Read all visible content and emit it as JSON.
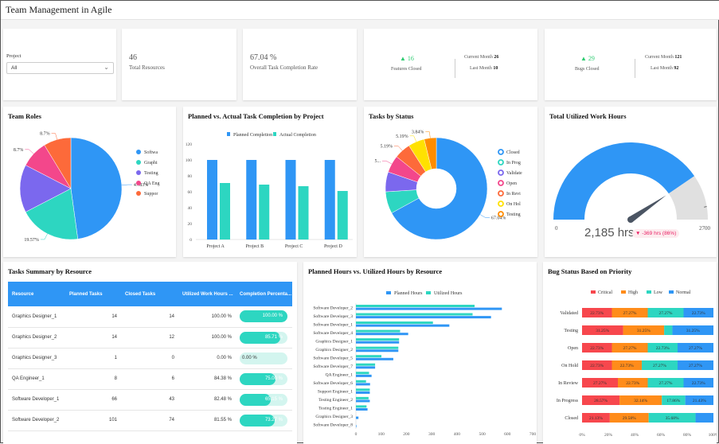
{
  "app": {
    "title": "Team Management in Agile"
  },
  "filters": {
    "project_label": "Project",
    "project_value": "All"
  },
  "kpis": {
    "total_resources": {
      "value": "46",
      "label": "Total Resources"
    },
    "completion_rate": {
      "value": "67.04 %",
      "label": "Overall Task Completion Rate"
    },
    "features": {
      "delta": "16",
      "label": "Features Closed",
      "current_label": "Current Month",
      "current": "26",
      "last_label": "Last Month",
      "last": "10"
    },
    "bugs": {
      "delta": "29",
      "label": "Bugs Closed",
      "current_label": "Current Month",
      "current": "121",
      "last_label": "Last Month",
      "last": "92"
    }
  },
  "colors": {
    "blue": "#2f96f5",
    "teal": "#2dd6c1",
    "purple": "#7b68ee",
    "pink": "#f3478b",
    "orange": "#fd6a3a",
    "yellow": "#ffe100",
    "amber": "#ff8c00",
    "red": "#f7474d",
    "gray": "#e0e0e0",
    "needle": "#4b5563",
    "up": "#2ecc71",
    "down": "#e91e63"
  },
  "chart_data": [
    {
      "id": "team_roles",
      "type": "pie",
      "title": "Team Roles",
      "labels": [
        "Software Developer",
        "Graphics Designer",
        "Testing Engineer",
        "QA Engineer",
        "Support Engineer"
      ],
      "legend_labels": [
        "Softwa",
        "Graphi",
        "Testing",
        "QA Eng",
        "Suppor"
      ],
      "values": [
        47.83,
        19.57,
        15.22,
        8.7,
        8.7
      ],
      "data_labels": [
        "47.83%",
        "19.57%",
        "",
        "8.7%",
        "8.7%"
      ],
      "colors": [
        "#2f96f5",
        "#2dd6c1",
        "#7b68ee",
        "#f3478b",
        "#fd6a3a"
      ],
      "legend": "right"
    },
    {
      "id": "planned_actual",
      "type": "bar",
      "title": "Planned vs. Actual Task Completion by Project",
      "categories": [
        "Project A",
        "Project B",
        "Project C",
        "Project D"
      ],
      "series": [
        {
          "name": "Planned Completion",
          "values": [
            100,
            100,
            100,
            100
          ],
          "color": "#2f96f5"
        },
        {
          "name": "Actual Completion",
          "values": [
            71,
            69,
            67,
            61
          ],
          "color": "#2dd6c1"
        }
      ],
      "ylim": [
        0,
        120
      ],
      "yticks": [
        0,
        20,
        40,
        60,
        80,
        100,
        120
      ],
      "legend": "top"
    },
    {
      "id": "tasks_status",
      "type": "pie",
      "donut": true,
      "title": "Tasks by Status",
      "labels": [
        "Closed",
        "In Progress",
        "Validated",
        "Open",
        "In Review",
        "On Hold",
        "Testing"
      ],
      "legend_labels": [
        "Closed",
        "In Prog",
        "Validate",
        "Open",
        "In Revi",
        "On Hol",
        "Testing"
      ],
      "values": [
        67.04,
        6.95,
        6.3,
        5.49,
        5.19,
        5.19,
        3.84
      ],
      "data_labels": [
        "67.04%",
        "",
        "",
        "5...",
        "5.19%",
        "5.19%",
        "3.84%"
      ],
      "colors": [
        "#2f96f5",
        "#2dd6c1",
        "#7b68ee",
        "#f3478b",
        "#fd6a3a",
        "#ffe100",
        "#ff8c00"
      ],
      "legend": "right"
    },
    {
      "id": "work_hours",
      "type": "gauge",
      "title": "Total Utilized Work Hours",
      "min": 0,
      "max": 2700,
      "min_label": "0",
      "max_label": "2700",
      "value": 2185,
      "target": 2554,
      "value_label": "2,185 hrs",
      "delta_label": "-369 hrs (86%)"
    },
    {
      "id": "hours_by_resource",
      "type": "bar",
      "orientation": "horizontal",
      "title": "Planned Hours vs. Utilized Hours by Resource",
      "categories": [
        "Software Developer_2",
        "Software Developer_3",
        "Software Developer_1",
        "Software Developer_4",
        "Graphics Designer_1",
        "Graphics Designer_2",
        "Software Developer_5",
        "Software Developer_7",
        "QA Engineer_1",
        "Software Developer_6",
        "Support Engineer_1",
        "Testing Engineer_2",
        "Testing Engineer_1",
        "Graphics Designer_3",
        "Software Developer_8"
      ],
      "series": [
        {
          "name": "Planned Hours",
          "values": [
            578,
            535,
            370,
            207,
            171,
            168,
            148,
            76,
            62,
            56,
            55,
            55,
            46,
            10,
            2
          ],
          "color": "#2f96f5"
        },
        {
          "name": "Utilized Hours",
          "values": [
            470,
            462,
            305,
            175,
            171,
            168,
            101,
            76,
            52,
            40,
            55,
            50,
            42,
            0,
            0
          ],
          "color": "#2dd6c1"
        }
      ],
      "xlim": [
        0,
        700
      ],
      "xticks": [
        0,
        100,
        200,
        300,
        400,
        500,
        600,
        700
      ],
      "legend": "top"
    },
    {
      "id": "bug_priority",
      "type": "bar",
      "orientation": "horizontal",
      "stacked": "percent",
      "title": "Bug Status Based on Priority",
      "categories": [
        "Validated",
        "Testing",
        "Open",
        "On Hold",
        "In Review",
        "In Progress",
        "Closed"
      ],
      "series": [
        {
          "name": "Critical",
          "values": [
            22.73,
            31.25,
            22.73,
            22.73,
            27.27,
            28.57,
            21.13
          ],
          "color": "#f7474d"
        },
        {
          "name": "High",
          "values": [
            27.27,
            31.25,
            27.27,
            22.73,
            22.73,
            32.14,
            29.58
          ],
          "color": "#ff8c1a"
        },
        {
          "name": "Low",
          "values": [
            27.27,
            6.25,
            22.73,
            27.27,
            27.27,
            17.86,
            35.68
          ],
          "color": "#2dd6c1"
        },
        {
          "name": "Normal",
          "values": [
            22.73,
            31.25,
            27.27,
            27.27,
            22.73,
            21.43,
            13.61
          ],
          "color": "#2f96f5"
        }
      ],
      "hidden_labels": [
        [],
        [
          2
        ],
        [],
        [],
        [],
        [],
        [
          3
        ]
      ],
      "xticks": [
        "0%",
        "20%",
        "40%",
        "60%",
        "80%",
        "100%"
      ],
      "legend": "top"
    }
  ],
  "table": {
    "title": "Tasks Summary by Resource",
    "columns": [
      "Resource",
      "Planned Tasks",
      "Closed Tasks",
      "Utilized Work Hours ...",
      "Completion Percenta..."
    ],
    "rows": [
      {
        "resource": "Graphics Designer_1",
        "planned": "14",
        "closed": "14",
        "utilized": "100.00 %",
        "completion": "100.00 %",
        "pct": 100
      },
      {
        "resource": "Graphics Designer_2",
        "planned": "14",
        "closed": "12",
        "utilized": "100.00 %",
        "completion": "85.71 %",
        "pct": 85.71
      },
      {
        "resource": "Graphics Designer_3",
        "planned": "1",
        "closed": "0",
        "utilized": "0.00 %",
        "completion": "0.00 %",
        "pct": 0
      },
      {
        "resource": "QA Engineer_1",
        "planned": "8",
        "closed": "6",
        "utilized": "84.38 %",
        "completion": "75.00 %",
        "pct": 75
      },
      {
        "resource": "Software Developer_1",
        "planned": "66",
        "closed": "43",
        "utilized": "82.48 %",
        "completion": "65.15 %",
        "pct": 65.15
      },
      {
        "resource": "Software Developer_2",
        "planned": "101",
        "closed": "74",
        "utilized": "81.55 %",
        "completion": "73.27 %",
        "pct": 73.27
      }
    ]
  }
}
